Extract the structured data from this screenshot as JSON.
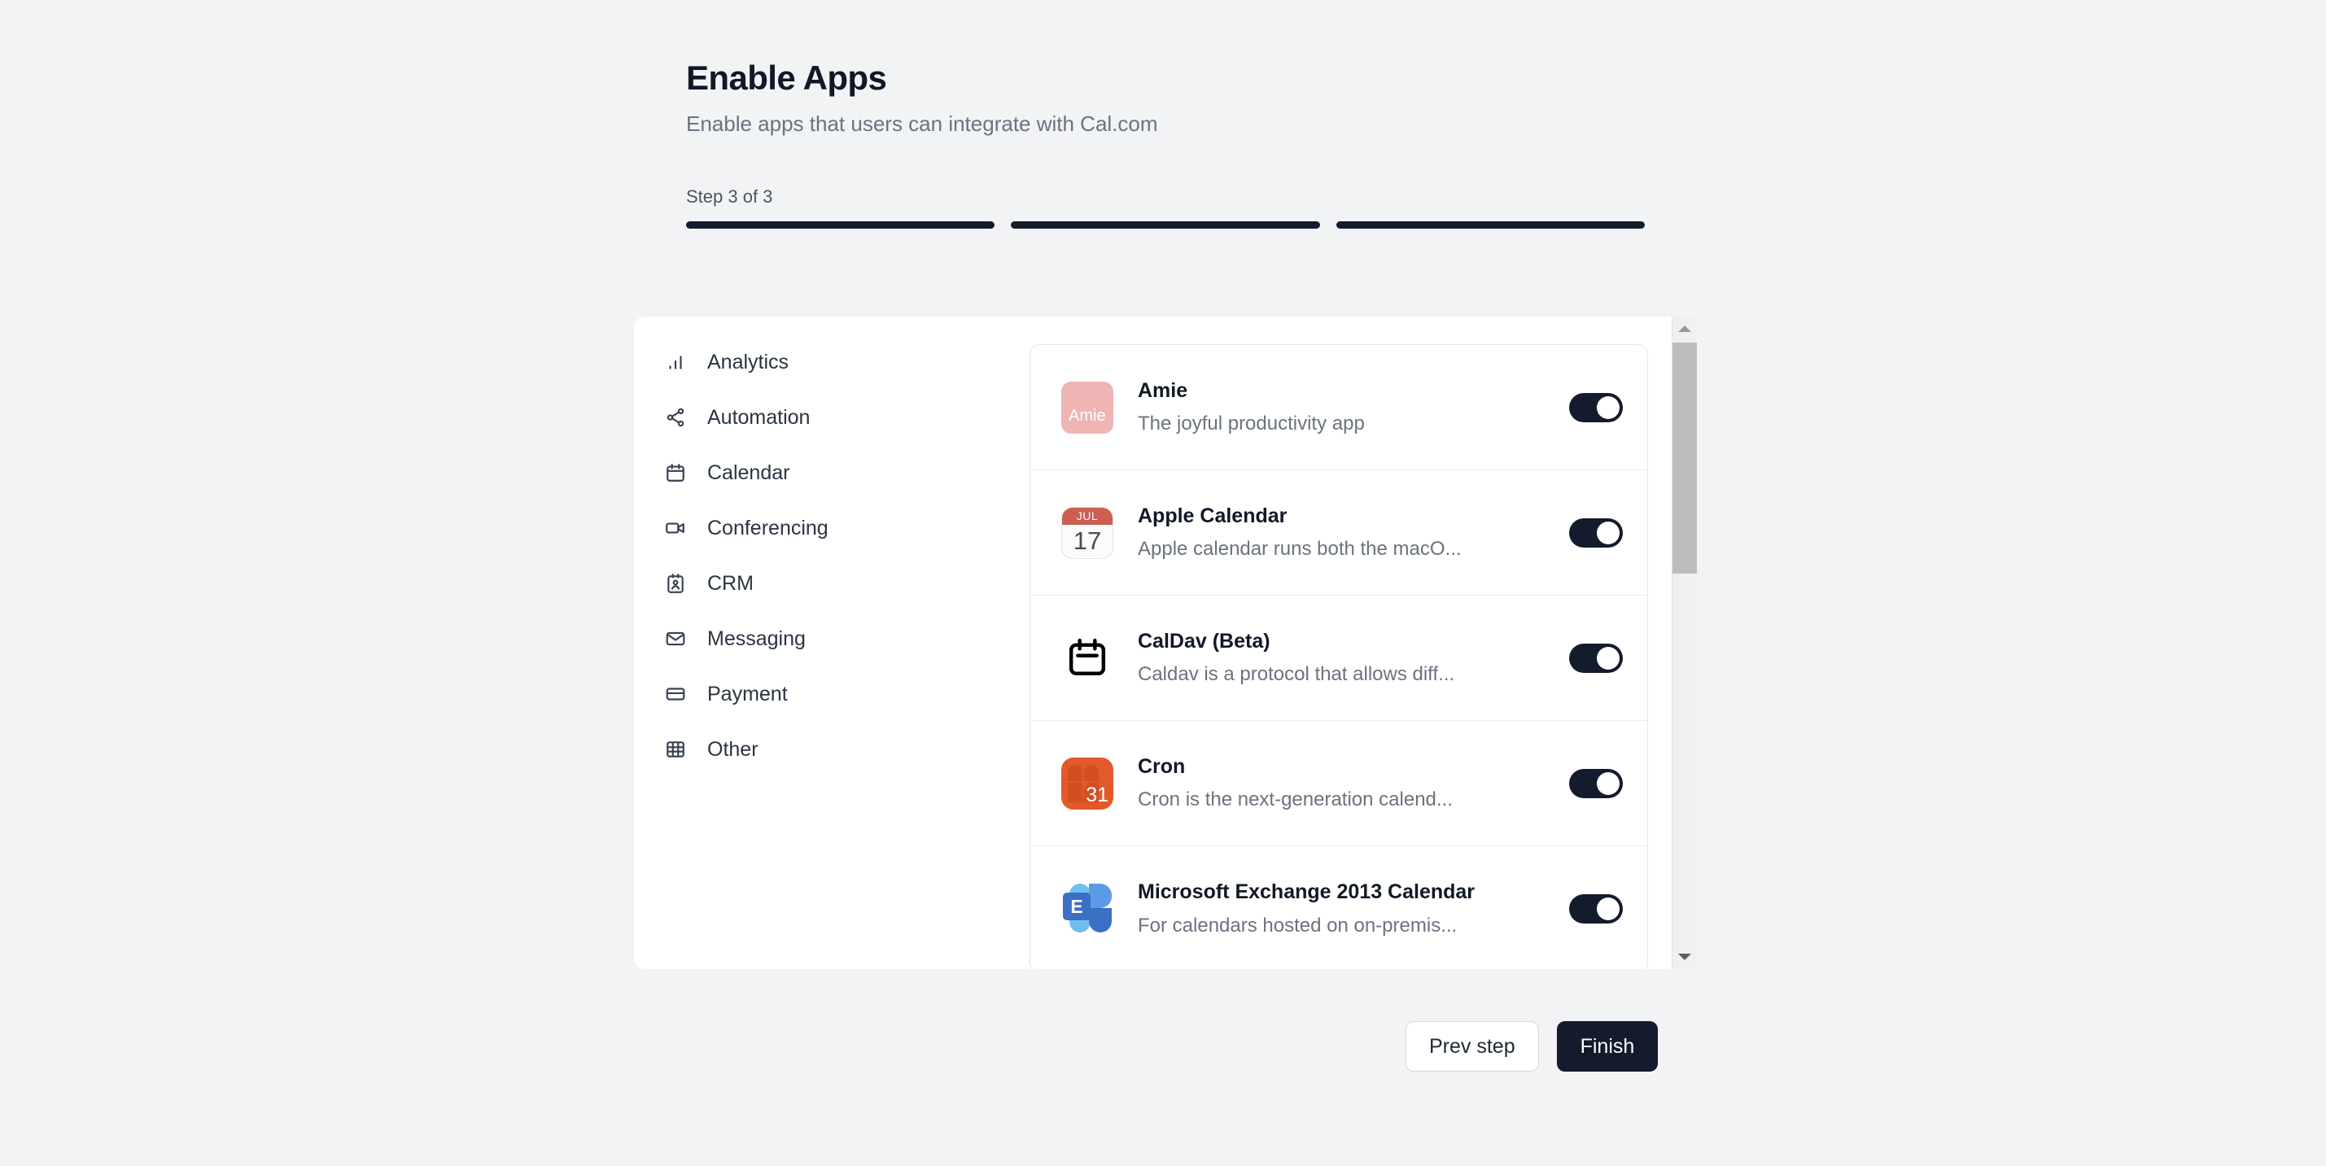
{
  "wizard": {
    "title": "Enable Apps",
    "subtitle": "Enable apps that users can integrate with Cal.com",
    "step_label": "Step 3 of 3",
    "total_steps": 3,
    "current_step": 3,
    "progress_filled": [
      true,
      true,
      true
    ]
  },
  "categories": [
    {
      "label": "Analytics",
      "icon": "bar-chart-icon"
    },
    {
      "label": "Automation",
      "icon": "share-nodes-icon"
    },
    {
      "label": "Calendar",
      "icon": "calendar-icon"
    },
    {
      "label": "Conferencing",
      "icon": "video-camera-icon"
    },
    {
      "label": "CRM",
      "icon": "contact-card-icon"
    },
    {
      "label": "Messaging",
      "icon": "envelope-icon"
    },
    {
      "label": "Payment",
      "icon": "credit-card-icon"
    },
    {
      "label": "Other",
      "icon": "grid-icon"
    }
  ],
  "apps": [
    {
      "name": "Amie",
      "description": "The joyful productivity app",
      "icon": "amie-app-icon",
      "enabled": true,
      "icon_text": "Amie",
      "icon_color": "#EFB4B4"
    },
    {
      "name": "Apple Calendar",
      "description": "Apple calendar runs both the macO...",
      "icon": "apple-calendar-app-icon",
      "enabled": true,
      "icon_month": "JUL",
      "icon_day": "17",
      "icon_color": "#CC5F51"
    },
    {
      "name": "CalDav (Beta)",
      "description": "Caldav is a protocol that allows diff...",
      "icon": "caldav-app-icon",
      "enabled": true,
      "icon_color": "#000000"
    },
    {
      "name": "Cron",
      "description": "Cron is the next-generation calend...",
      "icon": "cron-app-icon",
      "enabled": true,
      "icon_day": "31",
      "icon_color": "#E2592A"
    },
    {
      "name": "Microsoft Exchange 2013 Calendar",
      "description": "For calendars hosted on on-premis...",
      "icon": "microsoft-exchange-app-icon",
      "enabled": true,
      "icon_letter": "E",
      "icon_color": "#4A8EE0"
    }
  ],
  "scrollbar": {
    "up_arrow": "scroll-up-arrow-icon",
    "down_arrow": "scroll-down-arrow-icon"
  },
  "footer": {
    "prev_label": "Prev step",
    "finish_label": "Finish"
  },
  "colors": {
    "page_background": "#F2F3F5",
    "panel_background": "#FFFFFF",
    "accent_dark": "#141B2D",
    "muted_text": "#6B7280"
  }
}
